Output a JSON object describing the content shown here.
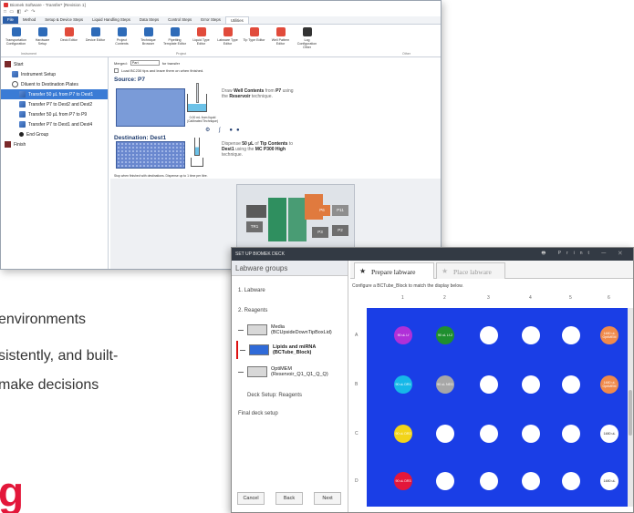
{
  "window1": {
    "title": "Biomek Software - Transfer* [Revision 1]",
    "quick_access": "□ ▭ ◧ ↶ ↷",
    "tabs": [
      "File",
      "Method",
      "Setup & Device Steps",
      "Liquid Handling Steps",
      "Data Steps",
      "Control Steps",
      "Error Steps",
      "Utilities"
    ],
    "selected_tab": "Utilities",
    "ribbon": [
      {
        "label": "Transportation Configuration",
        "color": "#2e6bb8"
      },
      {
        "label": "Hardware Setup",
        "color": "#2e6bb8"
      },
      {
        "label": "Deck Editor",
        "color": "#e14b3b"
      },
      {
        "label": "Device Editor",
        "color": "#2e6bb8"
      },
      {
        "label": "Project Contents",
        "color": "#2e6bb8"
      },
      {
        "label": "Technique Browser",
        "color": "#2e6bb8"
      },
      {
        "label": "Pipetting Template Editor",
        "color": "#2e6bb8"
      },
      {
        "label": "Liquid Type Editor",
        "color": "#e14b3b"
      },
      {
        "label": "Labware Type Editor",
        "color": "#e14b3b"
      },
      {
        "label": "Tip Type Editor",
        "color": "#e14b3b"
      },
      {
        "label": "Well Pattern Editor",
        "color": "#e14b3b"
      },
      {
        "label": "Log Configuration Other",
        "color": "#333333"
      }
    ],
    "ribbon_groups": [
      "Instrument",
      "Project",
      "Other"
    ],
    "tree": [
      {
        "label": "Start",
        "indent": 0
      },
      {
        "label": "Instrument Setup",
        "indent": 1
      },
      {
        "label": "Diluent to Destination Plates",
        "indent": 1
      },
      {
        "label": "Transfer 50 µL from P7 to Dest1",
        "indent": 2,
        "selected": true
      },
      {
        "label": "Transfer P7 to Dest2 and Dest2",
        "indent": 2
      },
      {
        "label": "Transfer 50 µL from P7 to P9",
        "indent": 2
      },
      {
        "label": "Transfer P7 to Dest1 and Dest4",
        "indent": 2
      },
      {
        "label": "End Group",
        "indent": 2
      },
      {
        "label": "Finish",
        "indent": 0
      }
    ],
    "editor": {
      "merged_label": "Merged:",
      "merged_value": "Part",
      "for_transfer": "for transfer",
      "tip_note": "Load BC230 tips and leave them on when finished.",
      "source_title": "Source: P7",
      "source_desc": [
        "Draw",
        "Well Contents",
        "from",
        "P7",
        "using the",
        "Reservoir",
        "technique."
      ],
      "liquid_label": "0.00 mL from liquid (Calibrated Technique)",
      "dest_title": "Destination: Dest1",
      "dest_desc": [
        "Dispense",
        "50 µL",
        "of",
        "Tip Contents",
        "to",
        "Dest1",
        "using the",
        "MC P300 High",
        "technique."
      ],
      "finish_note": "Stop when finished with destinations. Dispense up to 1 time per litre."
    },
    "deck": [
      {
        "label": "P6",
        "color": "#e07a3e"
      },
      {
        "label": "P11",
        "color": "#8e8e8e"
      },
      {
        "label": "TR1",
        "color": "#6e6e6e"
      },
      {
        "label": "P3",
        "color": "#6e6e6e"
      },
      {
        "label": "P2",
        "color": "#6e6e6e"
      }
    ]
  },
  "page_text": {
    "line1": "environments",
    "line2": "sistently, and built-",
    "line3": "make decisions",
    "big_letter": "g"
  },
  "window2": {
    "title": "SET UP BIOMEK DECK",
    "controls": "🖶 Print  —  ✕",
    "left_header": "Labware groups",
    "groups": [
      "1. Labware",
      "2. Reagents"
    ],
    "reagents": [
      {
        "name": "Media",
        "sub": "(BCUpsideDownTipBoxLid)",
        "box": "#d8d8d8",
        "selected": false
      },
      {
        "name": "Lipids and miRNA",
        "sub": "(BCTube_Block)",
        "box": "#2f6ad8",
        "selected": true
      },
      {
        "name": "OptiMEM",
        "sub": "(Reservoir_Q1_Q1_Q_Q)",
        "box": "#d8d8d8",
        "selected": false
      }
    ],
    "deck_setup": "Deck Setup: Reagents",
    "final_deck": "Final deck setup",
    "buttons": {
      "cancel": "Cancel",
      "back": "Back",
      "next": "Next"
    },
    "tabs": {
      "prepare": "Prepare labware",
      "place": "Place labware"
    },
    "instruction": "Configure a BCTube_Block to match the display below.",
    "columns": [
      "1",
      "2",
      "3",
      "4",
      "5",
      "6"
    ],
    "rows": [
      "A",
      "B",
      "C",
      "D"
    ],
    "plate_color": "#1a3ee6",
    "wells": [
      [
        {
          "text": "90 uL Lf",
          "color": "#b030d8"
        },
        {
          "text": "90 uL Lf-2",
          "color": "#1f8f2f"
        },
        {
          "text": "",
          "color": "#ffffff"
        },
        {
          "text": "",
          "color": "#ffffff"
        },
        {
          "text": "",
          "color": "#ffffff"
        },
        {
          "text": "1480 uL OptiMEM",
          "color": "#f08a4b"
        }
      ],
      [
        {
          "text": "90 uL DR1",
          "color": "#16b8e8"
        },
        {
          "text": "90 uL NEG",
          "color": "#a7a7a7"
        },
        {
          "text": "",
          "color": "#ffffff"
        },
        {
          "text": "",
          "color": "#ffffff"
        },
        {
          "text": "",
          "color": "#ffffff"
        },
        {
          "text": "1480 uL OptiMEM",
          "color": "#f08a4b"
        }
      ],
      [
        {
          "text": "90 uL DR2",
          "color": "#f2d41a"
        },
        {
          "text": "",
          "color": "#ffffff"
        },
        {
          "text": "",
          "color": "#ffffff"
        },
        {
          "text": "",
          "color": "#ffffff"
        },
        {
          "text": "",
          "color": "#ffffff"
        },
        {
          "text": "1480 uL",
          "color": "#ffffff"
        }
      ],
      [
        {
          "text": "90 uL DR3",
          "color": "#e3173a"
        },
        {
          "text": "",
          "color": "#ffffff"
        },
        {
          "text": "",
          "color": "#ffffff"
        },
        {
          "text": "",
          "color": "#ffffff"
        },
        {
          "text": "",
          "color": "#ffffff"
        },
        {
          "text": "1480 uL",
          "color": "#ffffff"
        }
      ]
    ]
  }
}
